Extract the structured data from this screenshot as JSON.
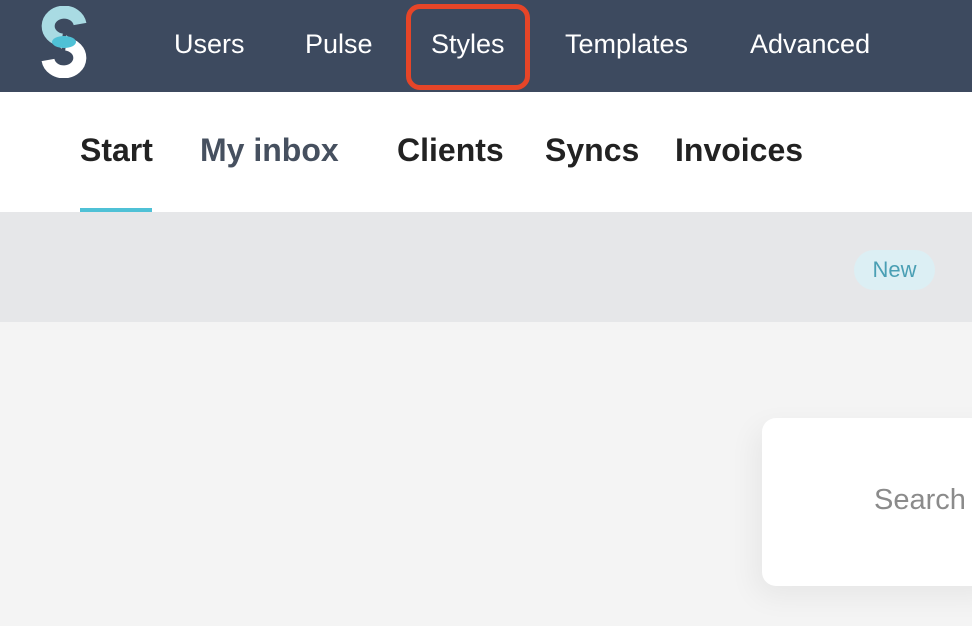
{
  "header": {
    "nav": [
      {
        "label": "Users"
      },
      {
        "label": "Pulse"
      },
      {
        "label": "Styles"
      },
      {
        "label": "Templates"
      },
      {
        "label": "Advanced"
      }
    ],
    "highlighted_item": "Styles"
  },
  "subnav": {
    "tabs": [
      {
        "label": "Start",
        "active": true
      },
      {
        "label": "My inbox",
        "active": false
      },
      {
        "label": "Clients",
        "active": false
      },
      {
        "label": "Syncs",
        "active": false
      },
      {
        "label": "Invoices",
        "active": false
      }
    ]
  },
  "toolbar": {
    "new_badge": "New"
  },
  "search": {
    "placeholder_visible": "Search f"
  },
  "colors": {
    "topbar": "#3d4a5f",
    "accent_underline": "#4fc1d6",
    "highlight_outline": "#e64528",
    "badge_bg": "#dceff4",
    "badge_text": "#4a9fb4"
  },
  "icons": {
    "logo": "s-logo-icon"
  }
}
